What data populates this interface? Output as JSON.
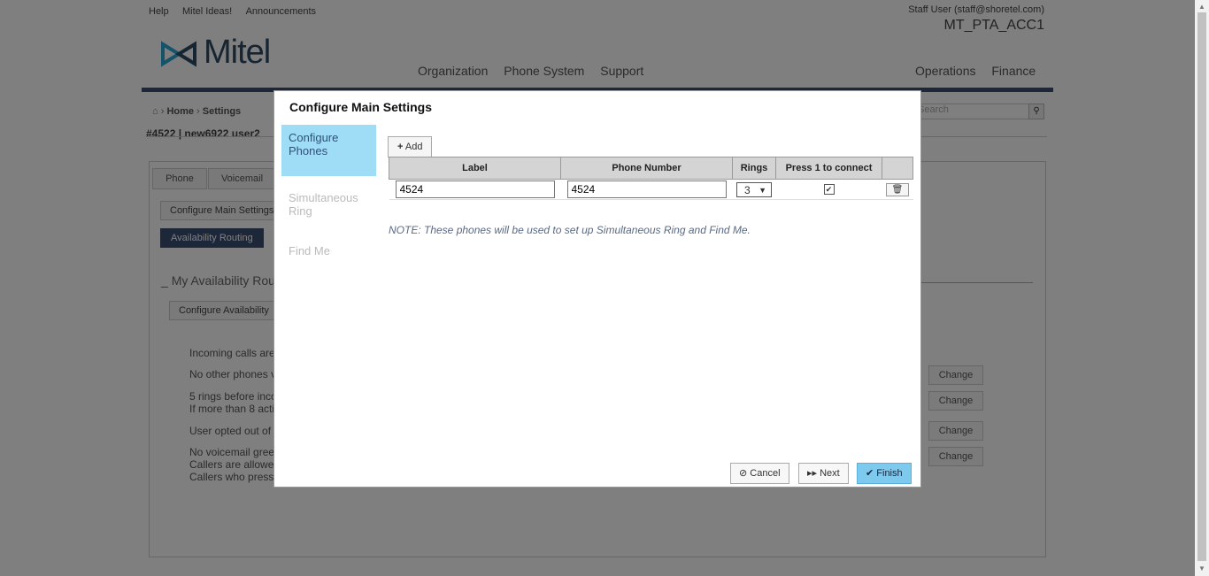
{
  "header": {
    "links": [
      "Help",
      "Mitel Ideas!",
      "Announcements"
    ],
    "user": "Staff User (staff@shoretel.com)",
    "account": "MT_PTA_ACC1",
    "logo_text": "Mitel",
    "nav_left": [
      "Organization",
      "Phone System",
      "Support"
    ],
    "nav_right": [
      "Operations",
      "Finance"
    ]
  },
  "breadcrumb": {
    "items": [
      "Home",
      "Settings"
    ],
    "title": "#4522 | new6922 user2",
    "search_placeholder": "Search"
  },
  "background": {
    "tabs": [
      "Phone",
      "Voicemail"
    ],
    "config_main_button": "Configure Main Settings",
    "availability_button": "Availability Routing",
    "section_title": "My Availability Routing",
    "config_availability_button": "Configure Availability",
    "lines": [
      "Incoming calls are",
      "No other phones v",
      "5 rings before inco",
      "If more than 8 acti",
      "User opted out of",
      "No voicemail gree",
      "Callers are allowe",
      "Callers who press"
    ],
    "change_label": "Change"
  },
  "modal": {
    "title": "Configure Main Settings",
    "side_items": [
      "Configure Phones",
      "Simultaneous Ring",
      "Find Me"
    ],
    "add_label": "Add",
    "columns": [
      "Label",
      "Phone Number",
      "Rings",
      "Press 1 to connect"
    ],
    "rows": [
      {
        "label": "4524",
        "phone": "4524",
        "rings": "3",
        "press1": true
      }
    ],
    "note": "NOTE: These phones will be used to set up Simultaneous Ring and Find Me.",
    "buttons": {
      "cancel": "Cancel",
      "next": "Next",
      "finish": "Finish"
    }
  }
}
